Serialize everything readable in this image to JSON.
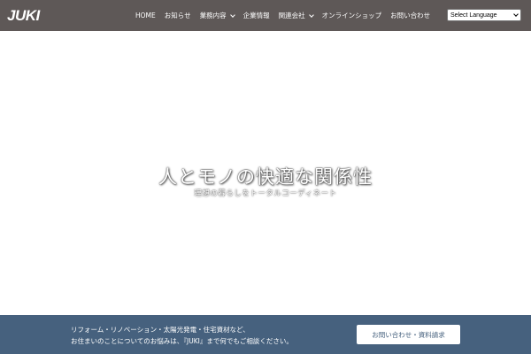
{
  "header": {
    "logo": "JUKI",
    "nav": [
      {
        "label": "HOME",
        "dropdown": false
      },
      {
        "label": "お知らせ",
        "dropdown": false
      },
      {
        "label": "業務内容",
        "dropdown": true
      },
      {
        "label": "企業情報",
        "dropdown": false
      },
      {
        "label": "関連会社",
        "dropdown": true
      },
      {
        "label": "オンラインショップ",
        "dropdown": false
      },
      {
        "label": "お問い合わせ",
        "dropdown": false
      }
    ],
    "language_select": "Select Language"
  },
  "hero": {
    "title": "人とモノの快適な関係性",
    "subtitle": "理想の暮らしをトータルコーディネート"
  },
  "footer": {
    "line1": "リフォーム・リノベーション・太陽光発電・住宅資材など、",
    "line2": "お住まいのことについてのお悩みは、『JUKI』まで何でもご相談ください。",
    "cta": "お問い合わせ・資料請求"
  },
  "colors": {
    "header_bg": "#5e5857",
    "footer_bg": "#46617e"
  }
}
